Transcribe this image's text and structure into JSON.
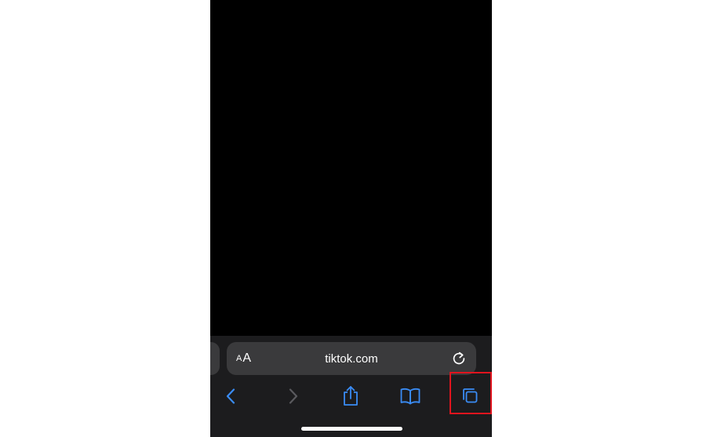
{
  "address_bar": {
    "text_size_small": "A",
    "text_size_large": "A",
    "url": "tiktok.com"
  },
  "toolbar": {
    "icons": [
      "chevron-left-icon",
      "chevron-right-icon",
      "share-icon",
      "book-icon",
      "tabs-icon"
    ],
    "forward_enabled": false
  },
  "colors": {
    "accent": "#3a8cf5",
    "disabled": "#5a5a5e",
    "chrome_bg": "#1c1c1e",
    "field_bg": "#3a3a3c",
    "highlight": "#e0141e"
  }
}
